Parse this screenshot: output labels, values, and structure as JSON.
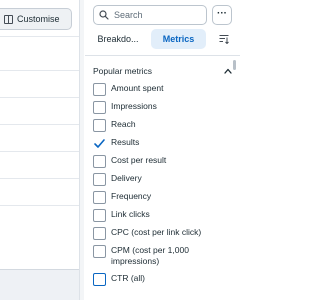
{
  "toolbar": {
    "customise_label": "Customise"
  },
  "search": {
    "placeholder": "Search",
    "value": ""
  },
  "more_label": "···",
  "tabs": [
    {
      "label": "Breakdo..."
    },
    {
      "label": "Metrics",
      "active": true
    }
  ],
  "section": {
    "title": "Popular metrics",
    "expanded": true
  },
  "metrics": [
    {
      "label": "Amount spent",
      "checked": false
    },
    {
      "label": "Impressions",
      "checked": false
    },
    {
      "label": "Reach",
      "checked": false
    },
    {
      "label": "Results",
      "checked": true
    },
    {
      "label": "Cost per result",
      "checked": false
    },
    {
      "label": "Delivery",
      "checked": false
    },
    {
      "label": "Frequency",
      "checked": false
    },
    {
      "label": "Link clicks",
      "checked": false
    },
    {
      "label": "CPC (cost per link click)",
      "checked": false
    },
    {
      "label": "CPM (cost per 1,000 impressions)",
      "checked": false
    },
    {
      "label": "CTR (all)",
      "checked": false,
      "focused": true
    }
  ],
  "colors": {
    "accent": "#0a66c2",
    "active_tab_bg": "#e2eefa",
    "text": "#1c2b33"
  }
}
